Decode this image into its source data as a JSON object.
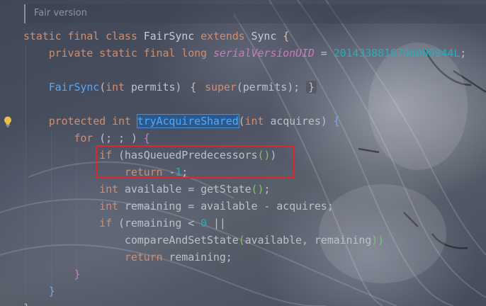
{
  "editor": {
    "hint": "Fair version",
    "lines": [
      {
        "tokens": [
          {
            "text": "static final class ",
            "cls": "kw"
          },
          {
            "text": "FairSync ",
            "cls": "cls"
          },
          {
            "text": "extends ",
            "cls": "kw"
          },
          {
            "text": "Sync ",
            "cls": "cls"
          },
          {
            "text": "{",
            "cls": "brace-y"
          }
        ]
      },
      {
        "tokens": [
          {
            "text": "    private static final long ",
            "cls": "kw"
          },
          {
            "text": "serialVersionUID",
            "cls": "field"
          },
          {
            "text": " = ",
            "cls": "plain"
          },
          {
            "text": "2014338818796000944L",
            "cls": "num"
          },
          {
            "text": ";",
            "cls": "plain"
          }
        ]
      },
      {
        "tokens": []
      },
      {
        "tokens": [
          {
            "text": "    ",
            "cls": "plain"
          },
          {
            "text": "FairSync",
            "cls": "fn"
          },
          {
            "text": "(",
            "cls": "plain"
          },
          {
            "text": "int ",
            "cls": "kw"
          },
          {
            "text": "permits",
            "cls": "plain"
          },
          {
            "text": ") ",
            "cls": "plain"
          },
          {
            "text": "{ ",
            "cls": "plain folded"
          },
          {
            "text": "super",
            "cls": "kw"
          },
          {
            "text": "(permits); ",
            "cls": "plain"
          },
          {
            "text": "}",
            "cls": "plain folded"
          }
        ]
      },
      {
        "tokens": []
      },
      {
        "tokens": [
          {
            "text": "    protected int ",
            "cls": "kw"
          },
          {
            "text": "tryAcquireShared",
            "cls": "fn selected"
          },
          {
            "text": "(",
            "cls": "plain"
          },
          {
            "text": "int ",
            "cls": "kw"
          },
          {
            "text": "acquires) ",
            "cls": "plain"
          },
          {
            "text": "{",
            "cls": "brace-b"
          }
        ]
      },
      {
        "tokens": [
          {
            "text": "        for ",
            "cls": "kw"
          },
          {
            "text": "(; ; ) ",
            "cls": "plain"
          },
          {
            "text": "{",
            "cls": "brace-p"
          }
        ]
      },
      {
        "tokens": [
          {
            "text": "            if ",
            "cls": "kw"
          },
          {
            "text": "(hasQueuedPredecessors",
            "cls": "call"
          },
          {
            "text": "()",
            "cls": "paren-g"
          },
          {
            "text": ")",
            "cls": "plain"
          }
        ]
      },
      {
        "tokens": [
          {
            "text": "                return ",
            "cls": "kw"
          },
          {
            "text": "-",
            "cls": "plain"
          },
          {
            "text": "1",
            "cls": "num"
          },
          {
            "text": ";",
            "cls": "plain"
          }
        ]
      },
      {
        "tokens": [
          {
            "text": "            int ",
            "cls": "kw"
          },
          {
            "text": "available = getState",
            "cls": "plain"
          },
          {
            "text": "()",
            "cls": "paren-g"
          },
          {
            "text": ";",
            "cls": "plain"
          }
        ]
      },
      {
        "tokens": [
          {
            "text": "            int ",
            "cls": "kw"
          },
          {
            "text": "remaining = available - acquires;",
            "cls": "plain"
          }
        ]
      },
      {
        "tokens": [
          {
            "text": "            if ",
            "cls": "kw"
          },
          {
            "text": "(remaining < ",
            "cls": "plain"
          },
          {
            "text": "0",
            "cls": "num"
          },
          {
            "text": " ||",
            "cls": "plain"
          }
        ]
      },
      {
        "tokens": [
          {
            "text": "                compareAndSetState",
            "cls": "plain"
          },
          {
            "text": "(",
            "cls": "paren-g"
          },
          {
            "text": "available, remaining",
            "cls": "plain"
          },
          {
            "text": "))",
            "cls": "paren-g"
          }
        ]
      },
      {
        "tokens": [
          {
            "text": "                return ",
            "cls": "kw"
          },
          {
            "text": "remaining;",
            "cls": "plain"
          }
        ]
      },
      {
        "tokens": [
          {
            "text": "        }",
            "cls": "brace-p"
          }
        ]
      },
      {
        "tokens": [
          {
            "text": "    }",
            "cls": "brace-b"
          }
        ]
      },
      {
        "tokens": [
          {
            "text": "}",
            "cls": "brace-y"
          }
        ]
      }
    ]
  },
  "colors": {
    "keyword": "#cf8e6d",
    "number": "#2aacb8",
    "method_declaration": "#56a8f5",
    "static_field": "#c77dbb",
    "highlight_box": "#e0262b"
  },
  "icons": {
    "gutter": "lightbulb-icon"
  }
}
